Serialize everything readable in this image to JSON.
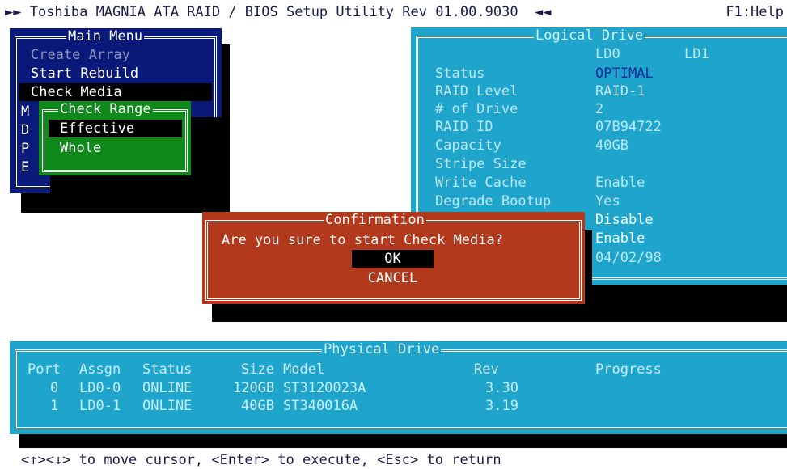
{
  "header": {
    "title": "►► Toshiba MAGNIA ATA RAID / BIOS Setup Utility Rev 01.00.9030  ◄◄",
    "help": "F1:Help"
  },
  "main_menu": {
    "title": "Main Menu",
    "items": [
      "Create Array",
      "Start Rebuild",
      "Check Media",
      "M",
      "D",
      "P",
      "E"
    ],
    "selected": "Check Media"
  },
  "check_range": {
    "title": "Check Range",
    "options": [
      "Effective",
      "Whole"
    ],
    "selected": "Effective"
  },
  "logical_drive": {
    "title": "Logical Drive",
    "columns": [
      "LD0",
      "LD1"
    ],
    "rows": [
      {
        "label": "Status",
        "value": "OPTIMAL"
      },
      {
        "label": "RAID Level",
        "value": "RAID-1"
      },
      {
        "label": "# of Drive",
        "value": "2"
      },
      {
        "label": "RAID ID",
        "value": "07B94722"
      },
      {
        "label": "Capacity",
        "value": "40GB"
      },
      {
        "label": "Stripe Size",
        "value": ""
      },
      {
        "label": "Write Cache",
        "value": "Enable"
      },
      {
        "label": "Degrade Bootup",
        "value": "Yes"
      },
      {
        "label": "",
        "value": "Disable"
      },
      {
        "label": "",
        "value": "Enable"
      },
      {
        "label": "",
        "value": "04/02/98"
      }
    ]
  },
  "confirmation": {
    "title": "Confirmation",
    "message": "Are you sure to start Check Media?",
    "ok_label": "OK",
    "cancel_label": "CANCEL"
  },
  "physical_drive": {
    "title": "Physical Drive",
    "headers": {
      "port": "Port",
      "assgn": "Assgn",
      "status": "Status",
      "size": "Size",
      "model": "Model",
      "rev": "Rev",
      "progress": "Progress"
    },
    "rows": [
      {
        "port": "0",
        "assgn": "LD0-0",
        "status": "ONLINE",
        "size": "120GB",
        "model": "ST3120023A",
        "rev": "3.30"
      },
      {
        "port": "1",
        "assgn": "LD0-1",
        "status": "ONLINE",
        "size": "40GB",
        "model": "ST340016A",
        "rev": "3.19"
      }
    ]
  },
  "footer": {
    "hint": "<↑><↓> to move cursor, <Enter> to execute, <Esc> to return"
  },
  "colors": {
    "main_menu_bg": "#0a1a7a",
    "check_range_bg": "#0e8a1a",
    "panel_bg": "#1fa5cc",
    "confirmation_bg": "#b2391b"
  }
}
